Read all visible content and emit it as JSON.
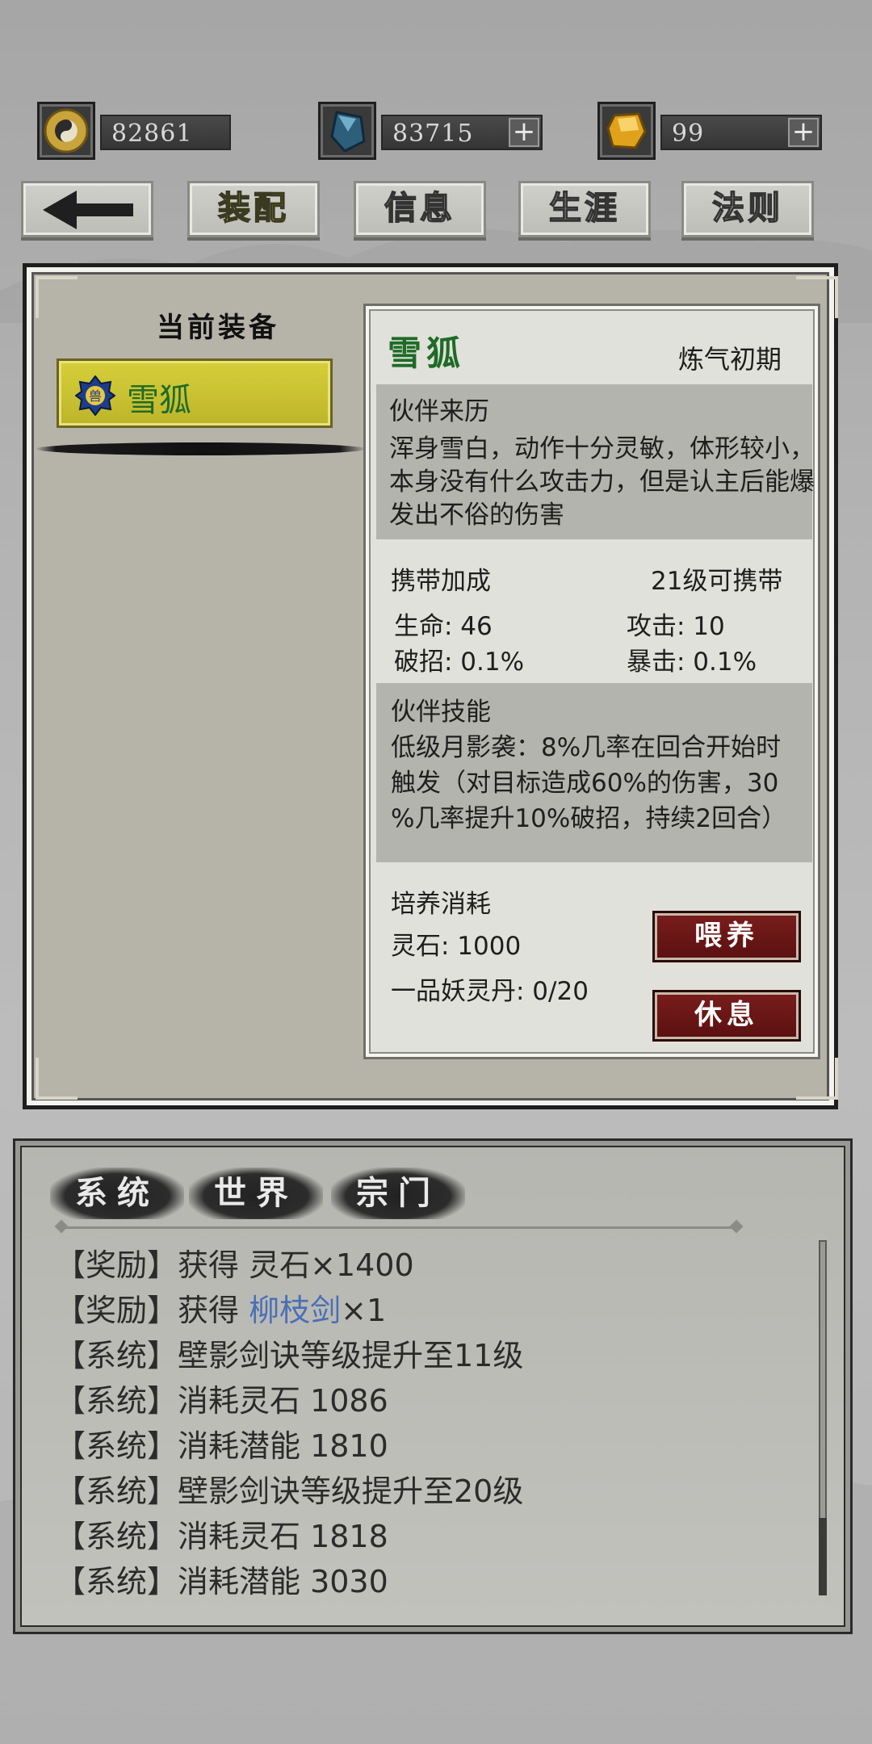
{
  "currencies": [
    {
      "name": "copper-coin",
      "value": "82861",
      "has_plus": false
    },
    {
      "name": "spirit-crystal",
      "value": "83715",
      "has_plus": true
    },
    {
      "name": "gold-gem",
      "value": "99",
      "has_plus": true
    }
  ],
  "nav": {
    "back_icon": "left-arrow-icon",
    "tabs": [
      "装配",
      "信息",
      "生涯",
      "法则"
    ],
    "active_tab": "装配"
  },
  "equip": {
    "title": "当前装备",
    "item_name": "雪狐"
  },
  "detail": {
    "name": "雪狐",
    "realm": "炼气初期",
    "origin_title": "伙伴来历",
    "origin_lines": [
      "浑身雪白，动作十分灵敏，体形较小，",
      "本身没有什么攻击力，但是认主后能爆",
      "发出不俗的伤害"
    ],
    "bonus_title": "携带加成",
    "carry_level": "21级可携带",
    "stats": {
      "hp": "生命: 46",
      "atk": "攻击: 10",
      "break": "破招: 0.1%",
      "crit": "暴击: 0.1%"
    },
    "skill_title": "伙伴技能",
    "skill_lines": [
      "低级月影袭：8%几率在回合开始时",
      "触发（对目标造成60%的伤害，30",
      "%几率提升10%破招，持续2回合）"
    ],
    "cost_title": "培养消耗",
    "cost_stone": "灵石: 1000",
    "cost_pill": "一品妖灵丹: 0/20",
    "feed_label": "喂养",
    "rest_label": "休息"
  },
  "chat": {
    "tabs": [
      "系统",
      "世界",
      "宗门"
    ],
    "lines": [
      {
        "prefix": "【奖励】获得 ",
        "highlight": "",
        "suffix": "灵石×1400"
      },
      {
        "prefix": "【奖励】获得 ",
        "highlight": "柳枝剑",
        "suffix": "×1"
      },
      {
        "prefix": "【系统】壁影剑诀等级提升至11级",
        "highlight": "",
        "suffix": ""
      },
      {
        "prefix": "【系统】消耗灵石 1086",
        "highlight": "",
        "suffix": ""
      },
      {
        "prefix": "【系统】消耗潜能 1810",
        "highlight": "",
        "suffix": ""
      },
      {
        "prefix": "【系统】壁影剑诀等级提升至20级",
        "highlight": "",
        "suffix": ""
      },
      {
        "prefix": "【系统】消耗灵石 1818",
        "highlight": "",
        "suffix": ""
      },
      {
        "prefix": "【系统】消耗潜能 3030",
        "highlight": "",
        "suffix": ""
      }
    ]
  },
  "colors": {
    "pet_name": "#1e6b26",
    "highlight_item": "#4a6fb5",
    "active_tab": "#e6d23a",
    "action_button": "#6a1616"
  }
}
